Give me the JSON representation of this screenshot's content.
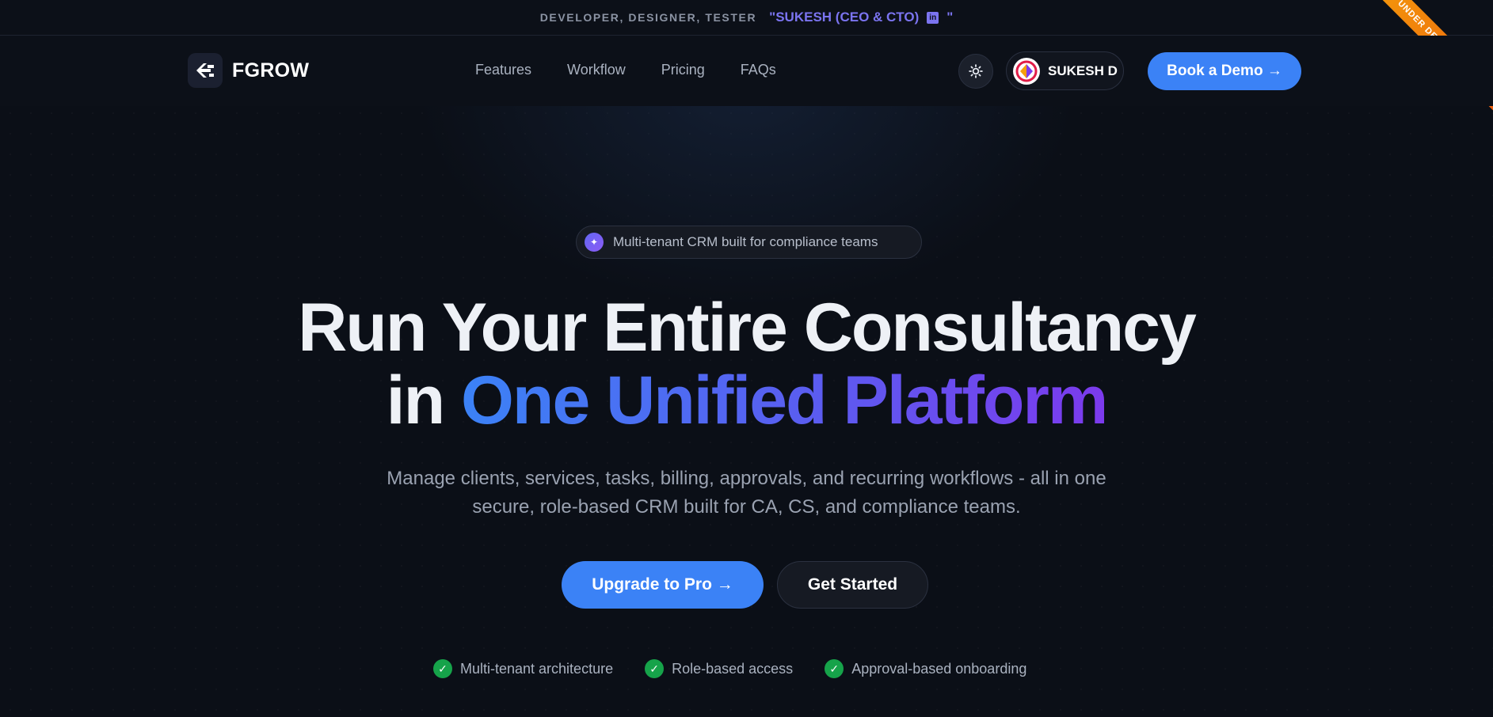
{
  "topbar": {
    "roles": "DEVELOPER, DESIGNER, TESTER",
    "quote_open": "\"SUKESH (CEO & CTO)",
    "linkedin_icon": "linkedin-icon",
    "quote_close": "\""
  },
  "ribbon": {
    "label": "UNDER DEVELOPMENT"
  },
  "nav": {
    "logo_text": "FGROW",
    "menu": [
      {
        "label": "Features"
      },
      {
        "label": "Workflow"
      },
      {
        "label": "Pricing"
      },
      {
        "label": "FAQs"
      }
    ],
    "theme_icon": "sun-icon",
    "user_name": "SUKESH D",
    "demo_label": "Book a Demo →"
  },
  "hero": {
    "pill_icon": "sparkle-icon",
    "pill_text": "Multi-tenant CRM built for compliance teams",
    "headline_line1": "Run Your Entire Consultancy",
    "headline_line2_prefix": "in",
    "headline_line2_highlight": "One Unified Platform",
    "subtitle": "Manage clients, services, tasks, billing, approvals, and recurring workflows - all in one secure, role-based CRM built for CA, CS, and compliance teams.",
    "cta_primary": "Upgrade to Pro →",
    "cta_secondary": "Get Started",
    "features": [
      {
        "label": "Multi-tenant architecture"
      },
      {
        "label": "Role-based access"
      },
      {
        "label": "Approval-based onboarding"
      }
    ]
  },
  "colors": {
    "background": "#0b0f17",
    "accent": "#3b82f6",
    "gradient_end": "#7c3aed",
    "quote": "#7b74f0",
    "check": "#16a34a",
    "ribbon": "#ea580c"
  }
}
